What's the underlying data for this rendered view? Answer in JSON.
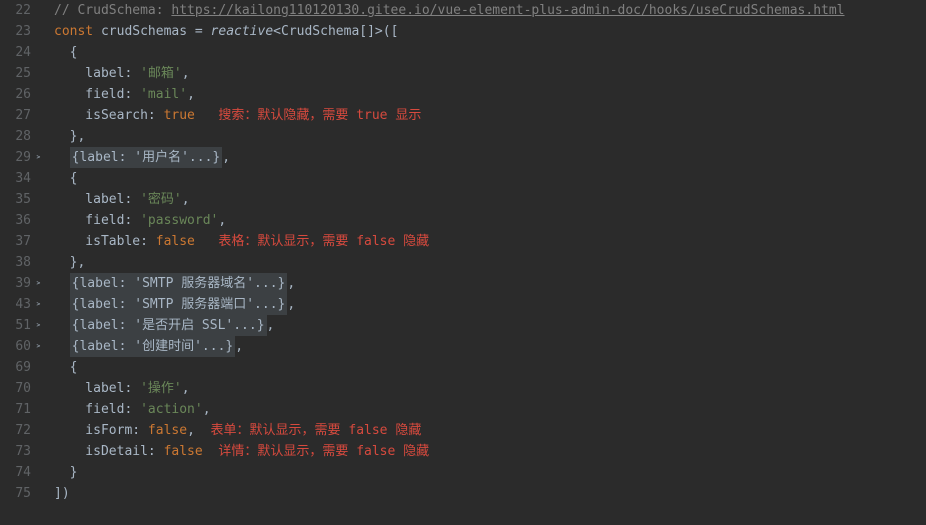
{
  "lines": [
    {
      "num": "22",
      "fold": false,
      "tokens": [
        {
          "cls": "c",
          "t": "// CrudSchema: "
        },
        {
          "cls": "c u",
          "t": "https://kailong110120130.gitee.io/vue-element-plus-admin-doc/hooks/useCrudSchemas.html"
        }
      ]
    },
    {
      "num": "23",
      "fold": false,
      "tokens": [
        {
          "cls": "kw",
          "t": "const "
        },
        {
          "cls": "id",
          "t": "crudSchemas = "
        },
        {
          "cls": "fn",
          "t": "reactive"
        },
        {
          "cls": "p",
          "t": "<"
        },
        {
          "cls": "ty",
          "t": "CrudSchema"
        },
        {
          "cls": "p",
          "t": "[]>(["
        }
      ]
    },
    {
      "num": "24",
      "fold": false,
      "tokens": [
        {
          "cls": "p",
          "t": "  {"
        }
      ]
    },
    {
      "num": "25",
      "fold": false,
      "tokens": [
        {
          "cls": "id",
          "t": "    label: "
        },
        {
          "cls": "s",
          "t": "'邮箱'"
        },
        {
          "cls": "p",
          "t": ","
        }
      ]
    },
    {
      "num": "26",
      "fold": false,
      "tokens": [
        {
          "cls": "id",
          "t": "    field: "
        },
        {
          "cls": "s",
          "t": "'mail'"
        },
        {
          "cls": "p",
          "t": ","
        }
      ]
    },
    {
      "num": "27",
      "fold": false,
      "tokens": [
        {
          "cls": "id",
          "t": "    isSearch: "
        },
        {
          "cls": "kw",
          "t": "true"
        },
        {
          "cls": "id",
          "t": "   "
        },
        {
          "cls": "red",
          "t": "搜索：默认隐藏，需要 true 显示"
        }
      ]
    },
    {
      "num": "28",
      "fold": false,
      "tokens": [
        {
          "cls": "p",
          "t": "  },"
        }
      ]
    },
    {
      "num": "29",
      "fold": true,
      "tokens": [
        {
          "cls": "p",
          "t": "  "
        },
        {
          "cls": "fold-bg",
          "t": "{label: '用户名'...}"
        },
        {
          "cls": "p",
          "t": ","
        }
      ]
    },
    {
      "num": "34",
      "fold": false,
      "tokens": [
        {
          "cls": "p",
          "t": "  {"
        }
      ]
    },
    {
      "num": "35",
      "fold": false,
      "tokens": [
        {
          "cls": "id",
          "t": "    label: "
        },
        {
          "cls": "s",
          "t": "'密码'"
        },
        {
          "cls": "p",
          "t": ","
        }
      ]
    },
    {
      "num": "36",
      "fold": false,
      "tokens": [
        {
          "cls": "id",
          "t": "    field: "
        },
        {
          "cls": "s",
          "t": "'password'"
        },
        {
          "cls": "p",
          "t": ","
        }
      ]
    },
    {
      "num": "37",
      "fold": false,
      "tokens": [
        {
          "cls": "id",
          "t": "    isTable: "
        },
        {
          "cls": "kw",
          "t": "false"
        },
        {
          "cls": "id",
          "t": "   "
        },
        {
          "cls": "red",
          "t": "表格：默认显示，需要 false 隐藏"
        }
      ]
    },
    {
      "num": "38",
      "fold": false,
      "tokens": [
        {
          "cls": "p",
          "t": "  },"
        }
      ]
    },
    {
      "num": "39",
      "fold": true,
      "tokens": [
        {
          "cls": "p",
          "t": "  "
        },
        {
          "cls": "fold-bg",
          "t": "{label: 'SMTP 服务器域名'...}"
        },
        {
          "cls": "p",
          "t": ","
        }
      ]
    },
    {
      "num": "43",
      "fold": true,
      "tokens": [
        {
          "cls": "p",
          "t": "  "
        },
        {
          "cls": "fold-bg",
          "t": "{label: 'SMTP 服务器端口'...}"
        },
        {
          "cls": "p",
          "t": ","
        }
      ]
    },
    {
      "num": "51",
      "fold": true,
      "tokens": [
        {
          "cls": "p",
          "t": "  "
        },
        {
          "cls": "fold-bg",
          "t": "{label: '是否开启 SSL'...}"
        },
        {
          "cls": "p",
          "t": ","
        }
      ]
    },
    {
      "num": "60",
      "fold": true,
      "tokens": [
        {
          "cls": "p",
          "t": "  "
        },
        {
          "cls": "fold-bg",
          "t": "{label: '创建时间'...}"
        },
        {
          "cls": "p",
          "t": ","
        }
      ]
    },
    {
      "num": "69",
      "fold": false,
      "tokens": [
        {
          "cls": "p",
          "t": "  {"
        }
      ]
    },
    {
      "num": "70",
      "fold": false,
      "tokens": [
        {
          "cls": "id",
          "t": "    label: "
        },
        {
          "cls": "s",
          "t": "'操作'"
        },
        {
          "cls": "p",
          "t": ","
        }
      ]
    },
    {
      "num": "71",
      "fold": false,
      "tokens": [
        {
          "cls": "id",
          "t": "    field: "
        },
        {
          "cls": "s",
          "t": "'action'"
        },
        {
          "cls": "p",
          "t": ","
        }
      ]
    },
    {
      "num": "72",
      "fold": false,
      "tokens": [
        {
          "cls": "id",
          "t": "    isForm: "
        },
        {
          "cls": "kw",
          "t": "false"
        },
        {
          "cls": "p",
          "t": ","
        },
        {
          "cls": "id",
          "t": "  "
        },
        {
          "cls": "red",
          "t": "表单：默认显示，需要 false 隐藏"
        }
      ]
    },
    {
      "num": "73",
      "fold": false,
      "tokens": [
        {
          "cls": "id",
          "t": "    isDetail: "
        },
        {
          "cls": "kw",
          "t": "false"
        },
        {
          "cls": "id",
          "t": "  "
        },
        {
          "cls": "red",
          "t": "详情：默认显示，需要 false 隐藏"
        }
      ]
    },
    {
      "num": "74",
      "fold": false,
      "tokens": [
        {
          "cls": "p",
          "t": "  }"
        }
      ]
    },
    {
      "num": "75",
      "fold": false,
      "tokens": [
        {
          "cls": "p",
          "t": "])"
        }
      ]
    }
  ],
  "fold_glyph": "﹥"
}
